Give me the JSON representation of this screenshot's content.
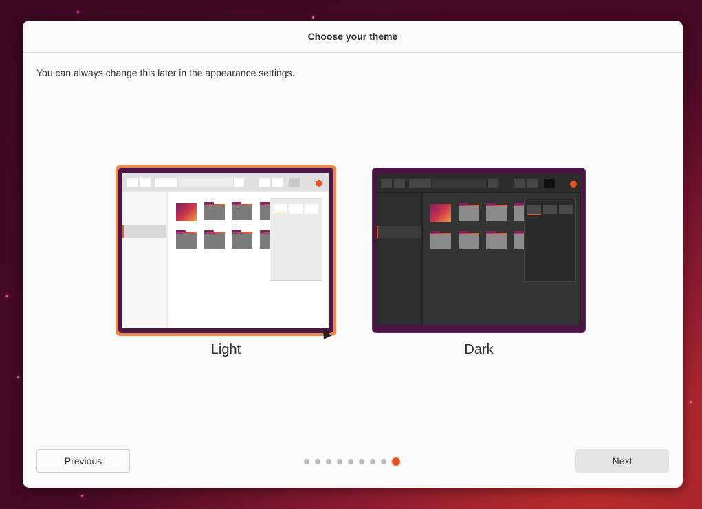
{
  "dialog": {
    "title": "Choose your theme",
    "subtitle": "You can always change this later in the appearance settings."
  },
  "themes": [
    {
      "label": "Light",
      "selected": true
    },
    {
      "label": "Dark",
      "selected": false
    }
  ],
  "navigation": {
    "previous_label": "Previous",
    "next_label": "Next",
    "total_steps": 9,
    "current_step": 9
  },
  "colors": {
    "accent": "#e95420",
    "selection_border": "#f0874e",
    "aubergine": "#4b1646"
  }
}
